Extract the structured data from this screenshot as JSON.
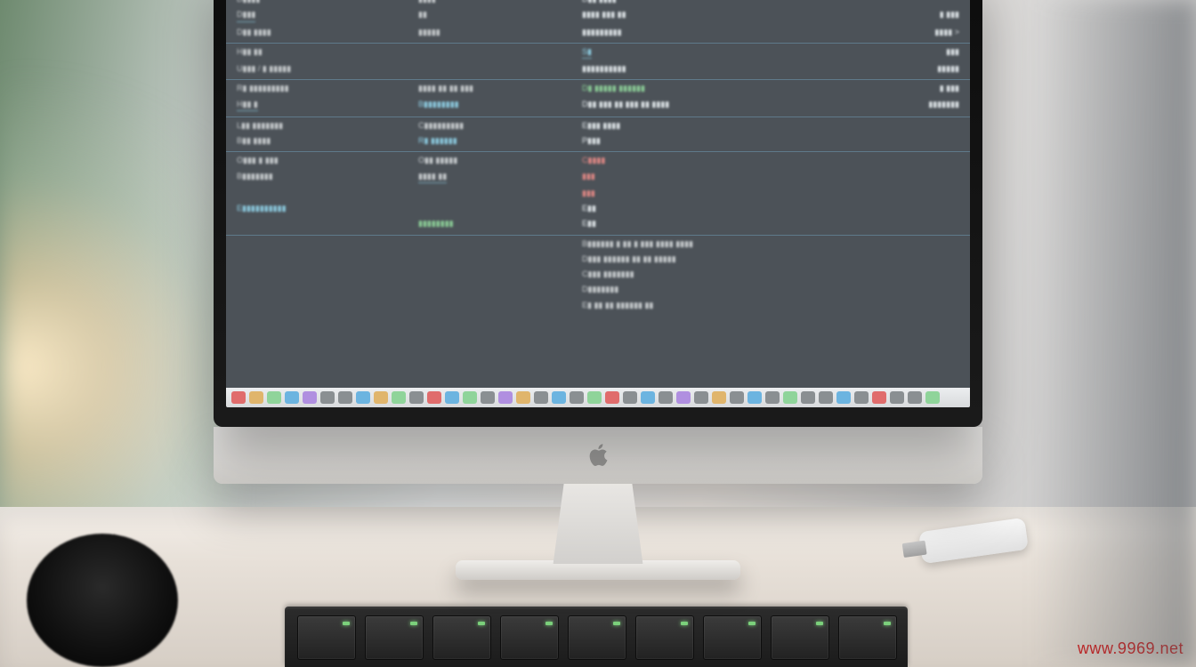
{
  "watermark": "www.9969.net",
  "note": "The monitor in this photograph displays an AI-generated / heavily stylised settings panel. Text on the screen is NOT legible — strings below are illegible placeholders, not real readings.",
  "screen": {
    "sections": [
      {
        "rows": [
          {
            "c1": "D▮▮▮▮",
            "c2": "▮▮▮▮",
            "c3": "D▮▮ ▮▮▮▮",
            "c4": ""
          },
          {
            "c1": "D▮▮▮",
            "c2": "▮▮",
            "c3": "▮▮▮▮ ▮▮▮ ▮▮",
            "c4": "▮ ▮▮▮",
            "c1cls": "ul"
          },
          {
            "c1": "D▮▮ ▮▮▮▮",
            "c2": "▮▮▮▮▮",
            "c3": "▮▮▮▮▮▮▮▮▮",
            "c4": "▮▮▮▮ >"
          }
        ]
      },
      {
        "rows": [
          {
            "c1": "H▮▮ ▮▮",
            "c2": "",
            "c3": "S▮",
            "c4": "▮▮▮",
            "c3cls": "cyan ul"
          },
          {
            "c1": "U▮▮▮ / ▮ ▮▮▮▮▮",
            "c2": "",
            "c3": "▮▮▮▮▮▮▮▮▮▮",
            "c4": "▮▮▮▮▮"
          }
        ]
      },
      {
        "rows": [
          {
            "c1": "R▮ ▮▮▮▮▮▮▮▮▮",
            "c2": "▮▮▮▮ ▮▮ ▮▮ ▮▮▮",
            "c3": "D▮ ▮▮▮▮▮",
            "c3b": "▮▮▮▮▮▮",
            "c4": "▮ ▮▮▮",
            "c3cls": "grn",
            "c3bcls": "grn"
          },
          {
            "c1": "H▮▮ ▮",
            "c2": "B▮▮▮▮▮▮▮▮",
            "c3": "D▮▮ ▮▮▮ ▮▮ ▮▮▮ ▮▮ ▮▮▮▮",
            "c4": "▮▮▮▮▮▮▮",
            "c1cls": "ul",
            "c2cls": "cyan"
          }
        ]
      },
      {
        "rows": [
          {
            "c1": "L▮▮ ▮▮▮▮▮▮▮",
            "c2": "C▮▮▮▮▮▮▮▮▮",
            "c3": "E▮▮▮ ▮▮▮▮",
            "c4": ""
          },
          {
            "c1": "B▮▮ ▮▮▮▮",
            "c2": "R▮ ▮▮▮▮▮▮",
            "c3": "P▮▮▮",
            "c4": "",
            "c2cls": "cyan"
          }
        ]
      },
      {
        "rows": [
          {
            "c1": "O▮▮▮ ▮",
            "c1b": "▮▮▮",
            "c2": "O▮▮ ▮▮▮▮▮",
            "c3": "C▮▮▮▮",
            "c4": "",
            "c3cls": "red"
          },
          {
            "c1": "B▮▮▮▮▮▮▮",
            "c2": "▮▮▮▮ ▮▮",
            "c3": "▮▮▮",
            "c4": "",
            "c2cls": "ul",
            "c3cls": "red"
          },
          {
            "c1": "",
            "c2": "",
            "c3": "▮▮▮",
            "c4": "",
            "c3cls": "red"
          },
          {
            "c1": "E▮▮▮▮▮▮▮▮▮▮",
            "c2": "",
            "c3": "E▮▮",
            "c4": "",
            "c1cls": "cyan"
          },
          {
            "c1": "",
            "c2": "▮▮▮▮▮▮▮▮",
            "c3": "E▮▮",
            "c4": "",
            "c2cls": "grn"
          }
        ]
      },
      {
        "noline": true,
        "rows": [
          {
            "wide": "B▮▮▮▮▮▮ ▮ ▮▮ ▮ ▮▮▮ ▮▮▮▮ ▮▮▮▮"
          },
          {
            "wide": "D▮▮▮ ▮▮▮▮▮▮ ▮▮ ▮▮ ▮▮▮▮▮"
          },
          {
            "wide": "C▮▮▮ ▮▮▮▮▮▮▮"
          },
          {
            "wide": "D▮▮▮▮▮▮▮"
          },
          {
            "wide": "E▮ ▮▮ ▮▮ ▮▮▮▮▮▮ ▮▮"
          }
        ]
      }
    ],
    "taskbar_colors": [
      "#e06c6c",
      "#e0b56c",
      "#8fd49a",
      "#6cb4e0",
      "#b08fe0",
      "#8a8f92",
      "#8a8f92",
      "#6cb4e0",
      "#e0b56c",
      "#8fd49a",
      "#8a8f92",
      "#e06c6c",
      "#6cb4e0",
      "#8fd49a",
      "#8a8f92",
      "#b08fe0",
      "#e0b56c",
      "#8a8f92",
      "#6cb4e0",
      "#8a8f92",
      "#8fd49a",
      "#e06c6c",
      "#8a8f92",
      "#6cb4e0",
      "#8a8f92",
      "#b08fe0",
      "#8a8f92",
      "#e0b56c",
      "#8a8f92",
      "#6cb4e0",
      "#8a8f92",
      "#8fd49a",
      "#8a8f92",
      "#8a8f92",
      "#6cb4e0",
      "#8a8f92",
      "#e06c6c",
      "#8a8f92",
      "#8a8f92",
      "#8fd49a"
    ]
  }
}
